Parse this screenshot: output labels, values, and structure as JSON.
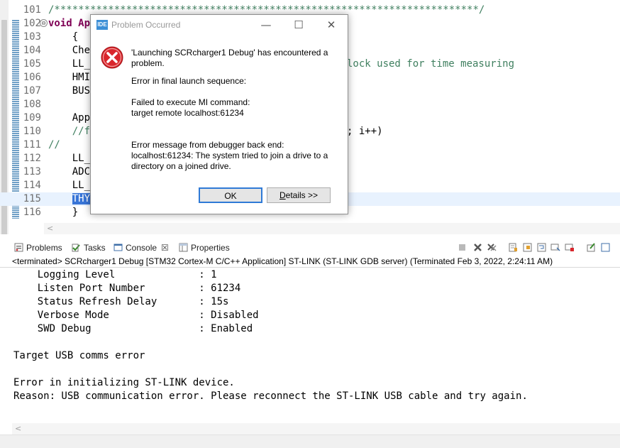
{
  "editor": {
    "lines": [
      {
        "num": "101",
        "text": "/***********************************************************************/",
        "style": "comment"
      },
      {
        "num": "102",
        "text": "void Ap",
        "style": "kw",
        "fold": "⊖"
      },
      {
        "num": "103",
        "text": "    {",
        "style": "plain"
      },
      {
        "num": "104",
        "text": "    Che",
        "style": "plain"
      },
      {
        "num": "105",
        "text": "    LL_",
        "style": "plain"
      },
      {
        "num": "106",
        "text": "    HMI",
        "style": "plain"
      },
      {
        "num": "107",
        "text": "    BUS",
        "style": "plain"
      },
      {
        "num": "108",
        "text": "",
        "style": "plain"
      },
      {
        "num": "109",
        "text": "    App",
        "style": "plain"
      },
      {
        "num": "110",
        "text": "    //f",
        "style": "comment"
      },
      {
        "num": "111",
        "text": "//",
        "style": "comment"
      },
      {
        "num": "112",
        "text": "    LL_",
        "style": "plain"
      },
      {
        "num": "113",
        "text": "    ADC",
        "style": "plain"
      },
      {
        "num": "114",
        "text": "    LL_",
        "style": "plain"
      },
      {
        "num": "115",
        "text": "    THY",
        "style": "selected"
      },
      {
        "num": "116",
        "text": "    }",
        "style": "plain"
      }
    ],
    "right_fragments": [
      {
        "line": 4,
        "text": "lock used for time measuring",
        "style": "comment"
      },
      {
        "line": 9,
        "text": "; i++)",
        "style": "plain"
      }
    ]
  },
  "views": {
    "tabs": [
      {
        "label": "Problems",
        "icon": "problems-icon"
      },
      {
        "label": "Tasks",
        "icon": "tasks-icon"
      },
      {
        "label": "Console",
        "icon": "console-icon",
        "active": true,
        "close": "☒"
      },
      {
        "label": "Properties",
        "icon": "properties-icon"
      }
    ]
  },
  "console": {
    "terminated_label": "<terminated> SCRcharger1 Debug [STM32 Cortex-M C/C++ Application] ST-LINK (ST-LINK GDB server) (Terminated Feb 3, 2022, 2:24:11 AM)",
    "lines": [
      "    Logging Level              : 1",
      "    Listen Port Number         : 61234",
      "    Status Refresh Delay       : 15s",
      "    Verbose Mode               : Disabled",
      "    SWD Debug                  : Enabled",
      "",
      "Target USB comms error",
      "",
      "Error in initializing ST-LINK device.",
      "Reason: USB communication error. Please reconnect the ST-LINK USB cable and try again."
    ]
  },
  "dialog": {
    "icon_text": "IDE",
    "title": "Problem Occurred",
    "minimize": "—",
    "maximize": "☐",
    "close": "✕",
    "message": "'Launching SCRcharger1 Debug' has encountered a\nproblem.",
    "error_header": "Error in final launch sequence:",
    "detail1": "Failed to execute MI command:\ntarget remote localhost:61234",
    "detail2": "Error message from debugger back end:\nlocalhost:61234: The system tried to join a drive to a\ndirectory on a joined drive.",
    "ok_label": "OK",
    "details_label_u": "D",
    "details_label_rest": "etails >>"
  },
  "colors": {
    "accent": "#2f7ad6",
    "error": "#d9262c",
    "comment": "#3f7f5f",
    "keyword": "#7f0055",
    "selection": "#3875d7"
  }
}
